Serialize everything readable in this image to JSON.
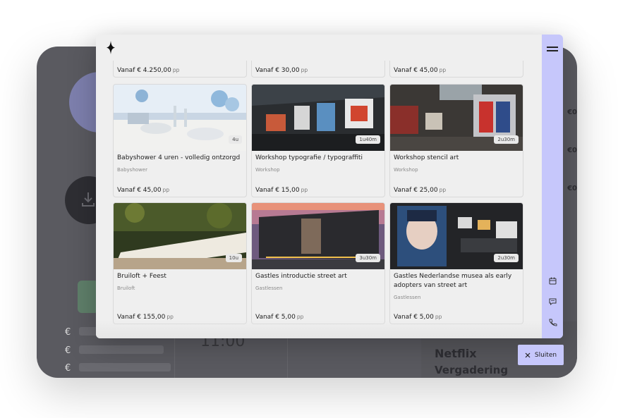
{
  "background": {
    "time_text": "11:00",
    "netflix_text": "Netflix",
    "meeting_text": "Vergadering",
    "euro_symbol": "€",
    "side_labels": [
      "€0",
      "€0",
      "€0"
    ]
  },
  "top_prices": [
    {
      "price": "Vanaf € 4.250,00",
      "unit": "pp"
    },
    {
      "price": "Vanaf € 30,00",
      "unit": "pp"
    },
    {
      "price": "Vanaf € 45,00",
      "unit": "pp"
    }
  ],
  "cards": [
    {
      "title": "Babyshower 4 uren - volledig ontzorgd",
      "category": "Babyshower",
      "price": "Vanaf € 45,00",
      "unit": "pp",
      "duration": "4u"
    },
    {
      "title": "Workshop typografie / typograffiti",
      "category": "Workshop",
      "price": "Vanaf € 15,00",
      "unit": "pp",
      "duration": "1u40m"
    },
    {
      "title": "Workshop stencil art",
      "category": "Workshop",
      "price": "Vanaf € 25,00",
      "unit": "pp",
      "duration": "2u30m"
    },
    {
      "title": "Bruiloft + Feest",
      "category": "Bruiloft",
      "price": "Vanaf € 155,00",
      "unit": "pp",
      "duration": "10u"
    },
    {
      "title": "Gastles introductie street art",
      "category": "Gastlessen",
      "price": "Vanaf € 5,00",
      "unit": "pp",
      "duration": "3u30m"
    },
    {
      "title": "Gastles Nederlandse musea als early adopters van street art",
      "category": "Gastlessen",
      "price": "Vanaf € 5,00",
      "unit": "pp",
      "duration": "2u30m"
    }
  ],
  "close_label": "Sluiten",
  "icons": {
    "menu": "hamburger-menu-icon",
    "calendar": "calendar-icon",
    "chat": "chat-icon",
    "phone": "phone-icon",
    "close": "close-icon",
    "logo": "diamond-logo"
  },
  "colors": {
    "accent": "#c6c7fb",
    "modal_bg": "#efefef"
  }
}
